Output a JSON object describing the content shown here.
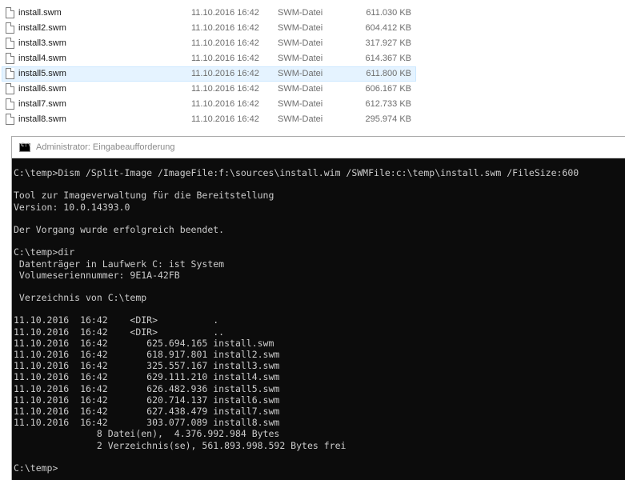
{
  "explorer": {
    "files": [
      {
        "name": "install.swm",
        "date": "11.10.2016 16:42",
        "type": "SWM-Datei",
        "size": "611.030 KB",
        "selected": false
      },
      {
        "name": "install2.swm",
        "date": "11.10.2016 16:42",
        "type": "SWM-Datei",
        "size": "604.412 KB",
        "selected": false
      },
      {
        "name": "install3.swm",
        "date": "11.10.2016 16:42",
        "type": "SWM-Datei",
        "size": "317.927 KB",
        "selected": false
      },
      {
        "name": "install4.swm",
        "date": "11.10.2016 16:42",
        "type": "SWM-Datei",
        "size": "614.367 KB",
        "selected": false
      },
      {
        "name": "install5.swm",
        "date": "11.10.2016 16:42",
        "type": "SWM-Datei",
        "size": "611.800 KB",
        "selected": true
      },
      {
        "name": "install6.swm",
        "date": "11.10.2016 16:42",
        "type": "SWM-Datei",
        "size": "606.167 KB",
        "selected": false
      },
      {
        "name": "install7.swm",
        "date": "11.10.2016 16:42",
        "type": "SWM-Datei",
        "size": "612.733 KB",
        "selected": false
      },
      {
        "name": "install8.swm",
        "date": "11.10.2016 16:42",
        "type": "SWM-Datei",
        "size": "295.974 KB",
        "selected": false
      }
    ],
    "file_icon": "document-icon"
  },
  "console": {
    "title": "Administrator: Eingabeaufforderung",
    "app_icon": "cmd-icon",
    "lines": [
      "C:\\temp>Dism /Split-Image /ImageFile:f:\\sources\\install.wim /SWMFile:c:\\temp\\install.swm /FileSize:600",
      "",
      "Tool zur Imageverwaltung für die Bereitstellung",
      "Version: 10.0.14393.0",
      "",
      "Der Vorgang wurde erfolgreich beendet.",
      "",
      "C:\\temp>dir",
      " Datenträger in Laufwerk C: ist System",
      " Volumeseriennummer: 9E1A-42FB",
      "",
      " Verzeichnis von C:\\temp",
      "",
      "11.10.2016  16:42    <DIR>          .",
      "11.10.2016  16:42    <DIR>          ..",
      "11.10.2016  16:42       625.694.165 install.swm",
      "11.10.2016  16:42       618.917.801 install2.swm",
      "11.10.2016  16:42       325.557.167 install3.swm",
      "11.10.2016  16:42       629.111.210 install4.swm",
      "11.10.2016  16:42       626.482.936 install5.swm",
      "11.10.2016  16:42       620.714.137 install6.swm",
      "11.10.2016  16:42       627.438.479 install7.swm",
      "11.10.2016  16:42       303.077.089 install8.swm",
      "               8 Datei(en),  4.376.992.984 Bytes",
      "               2 Verzeichnis(se), 561.893.998.592 Bytes frei",
      "",
      "C:\\temp>"
    ]
  },
  "colors": {
    "console_bg": "#0c0c0c",
    "console_text": "#cccccc",
    "selection_bg": "#e5f3ff"
  }
}
